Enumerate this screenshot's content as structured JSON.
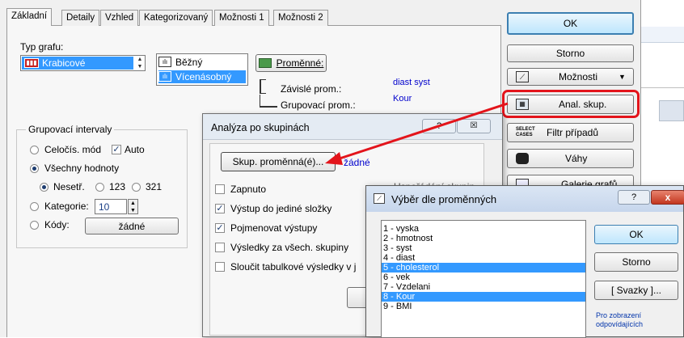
{
  "tabs": [
    "Základní",
    "Detaily",
    "Vzhled",
    "Kategorizovaný",
    "Možnosti 1",
    "Možnosti 2"
  ],
  "graph_type": {
    "label": "Typ grafu:",
    "selected": "Krabicové",
    "styles": [
      "Běžný",
      "Vícenásobný"
    ]
  },
  "variables_button": "Proměnné:",
  "dependent": {
    "label": "Závislé prom.:",
    "value": "diast syst"
  },
  "grouping": {
    "label": "Grupovací prom.:",
    "value": "Kour"
  },
  "intervals": {
    "title": "Grupovací intervaly",
    "integer_mode": "Celočís. mód",
    "auto": "Auto",
    "all_values": "Všechny hodnoty",
    "sub_options": [
      "Nesetř.",
      "123",
      "321"
    ],
    "categories_label": "Kategorie:",
    "categories_value": "10",
    "codes_label": "Kódy:",
    "codes_button": "žádné"
  },
  "right_buttons": {
    "ok": "OK",
    "cancel": "Storno",
    "options": "Možnosti",
    "anal_groups": "Anal. skup.",
    "filter": "Filtr případů",
    "filter_icon": "SELECT CASES",
    "weights": "Váhy",
    "gallery": "Galerie grafů"
  },
  "group_dialog": {
    "title": "Analýza po skupinách",
    "var_button": "Skup. proměnná(é)...",
    "var_value": "žádné",
    "checks": [
      {
        "label": "Zapnuto",
        "checked": false
      },
      {
        "label": "Výstup do jediné složky",
        "checked": true
      },
      {
        "label": "Pojmenovat výstupy",
        "checked": true
      },
      {
        "label": "Výsledky za všech. skupiny",
        "checked": false
      },
      {
        "label": "Sloučit tabulkové výsledky v j",
        "checked": false
      }
    ],
    "behind_text": "Uspořádání skupin",
    "help": "?",
    "close": "☒"
  },
  "select_dialog": {
    "title": "Výběr dle proměnných",
    "help": "?",
    "close": "x",
    "items": [
      {
        "label": "1 - vyska",
        "selected": false
      },
      {
        "label": "2 - hmotnost",
        "selected": false
      },
      {
        "label": "3 - syst",
        "selected": false
      },
      {
        "label": "4 - diast",
        "selected": false
      },
      {
        "label": "5 - cholesterol",
        "selected": true
      },
      {
        "label": "6 - vek",
        "selected": false
      },
      {
        "label": "7 - Vzdelani",
        "selected": false
      },
      {
        "label": "8 - Kour",
        "selected": true
      },
      {
        "label": "9 - BMI",
        "selected": false
      }
    ],
    "ok": "OK",
    "cancel": "Storno",
    "bundles": "[ Svazky ]...",
    "hint": "Pro zobrazení odpovídajících"
  },
  "colors": {
    "highlight_red": "#e3141b",
    "selection_blue": "#3399ff",
    "link_blue": "#0000cc"
  }
}
